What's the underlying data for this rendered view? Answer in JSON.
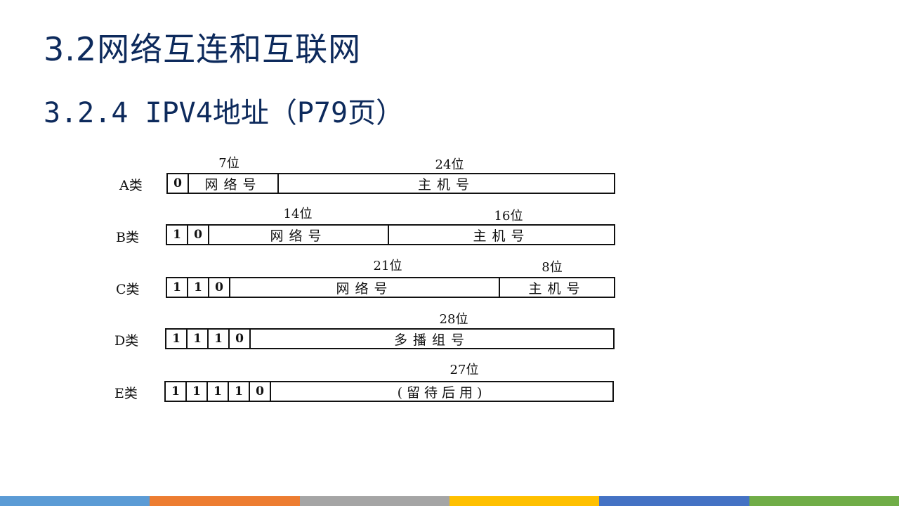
{
  "slide": {
    "title": "3.2网络互连和互联网",
    "subtitle": "3.2.4  IPV4地址（P79页）"
  },
  "diagram": {
    "rows": [
      {
        "label": "A类",
        "bits": [
          "0"
        ],
        "fields": [
          {
            "text": "网络号",
            "bits": "7位"
          },
          {
            "text": "主机号",
            "bits": "24位"
          }
        ]
      },
      {
        "label": "B类",
        "bits": [
          "1",
          "0"
        ],
        "fields": [
          {
            "text": "网络号",
            "bits": "14位"
          },
          {
            "text": "主机号",
            "bits": "16位"
          }
        ]
      },
      {
        "label": "C类",
        "bits": [
          "1",
          "1",
          "0"
        ],
        "fields": [
          {
            "text": "网络号",
            "bits": "21位"
          },
          {
            "text": "主机号",
            "bits": "8位"
          }
        ]
      },
      {
        "label": "D类",
        "bits": [
          "1",
          "1",
          "1",
          "0"
        ],
        "fields": [
          {
            "text": "多播组号",
            "bits": "28位"
          }
        ]
      },
      {
        "label": "E类",
        "bits": [
          "1",
          "1",
          "1",
          "1",
          "0"
        ],
        "fields": [
          {
            "text": "(留待后用)",
            "bits": "27位"
          }
        ]
      }
    ]
  },
  "footer": {
    "strip_colors": [
      "#5b9bd5",
      "#ed7d31",
      "#a5a5a5",
      "#ffc000",
      "#4472c4",
      "#70ad47"
    ]
  }
}
